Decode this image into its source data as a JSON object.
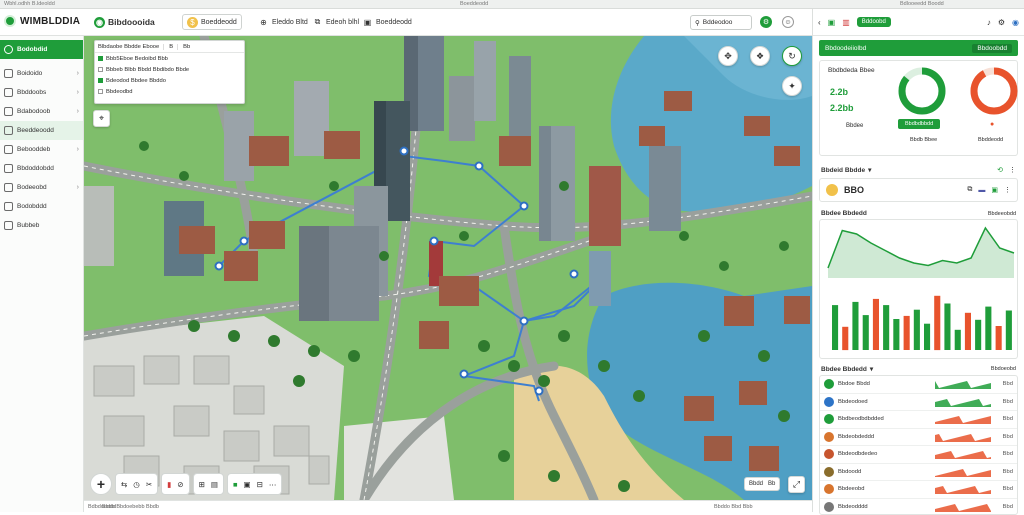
{
  "topstrip": {
    "left": "Wbhl.odhh  B.ldeoldd",
    "center": "Boeddeodd",
    "right": "Bdlooeedd Boodd"
  },
  "header": {
    "brand": "WIMBLDDIA",
    "tabs": [
      {
        "label": "Bibdoooida",
        "icon": "map-pin-icon"
      },
      {
        "label": "Boeddeodd",
        "icon": "coin-icon"
      },
      {
        "label": "Eleddo Bltd",
        "icon": "globe-icon"
      },
      {
        "label": "Edeoh blhl",
        "icon": "layers-icon"
      },
      {
        "label": "Boeddeodd",
        "icon": "building-icon"
      }
    ],
    "search_placeholder": "Bddeodoo",
    "icons": [
      "settings-icon",
      "user-icon"
    ]
  },
  "sidebar": {
    "items": [
      {
        "label": "Bodobdid",
        "icon": "home-icon",
        "state": "active"
      },
      {
        "label": "Boidoido",
        "icon": "list-icon",
        "chevron": true
      },
      {
        "label": "Bbddoobs",
        "icon": "chart-icon",
        "chevron": true
      },
      {
        "label": "Bdabodoob",
        "icon": "mail-icon",
        "chevron": true
      },
      {
        "label": "Beeddeoodd",
        "icon": "grid-icon",
        "state": "highlight"
      },
      {
        "label": "Bebooddeb",
        "icon": "folder-icon",
        "chevron": true
      },
      {
        "label": "Bbdoddobdd",
        "icon": "layers-icon"
      },
      {
        "label": "Bodeeobd",
        "icon": "box-icon",
        "chevron": true
      },
      {
        "label": "Bodobddd",
        "icon": "calendar-icon"
      },
      {
        "label": "Bubbeb",
        "icon": "doc-icon"
      }
    ]
  },
  "map_popup": {
    "top_cells": [
      "Blbdaobe Bbdde Ebooe",
      "B",
      "Bb"
    ],
    "rows": [
      {
        "label": "Bbb5Eboe Bedoibd Bbb",
        "checked": true
      },
      {
        "label": "Bbbeb Blbb Bbdd Bbdibdo Bbde",
        "checked": false
      },
      {
        "label": "Bdeodod Bbdee Bbddo",
        "checked": true
      },
      {
        "label": "Bbdeodbd",
        "checked": false
      }
    ]
  },
  "map_controls": {
    "top_right": [
      "compass-icon",
      "layers-icon",
      "refresh-icon"
    ],
    "extra": "target-icon",
    "left": "location-icon"
  },
  "toolbar": {
    "add": "+",
    "groups": [
      [
        "Bd",
        "Bd",
        "Bd"
      ],
      [
        "Bd",
        "Bd"
      ],
      [
        "Bd",
        "Bd"
      ],
      [
        "Bd",
        "Bbdd"
      ]
    ],
    "right_buttons": [
      "Bbdd",
      "Bb"
    ]
  },
  "footer": {
    "left": "Bdbdooddd",
    "left2": "Bbdo Bbdoebebb Bbdb",
    "right": "Bbddo Bbd Bbb"
  },
  "right_panel": {
    "top_tab": "Bddoobd",
    "green_bar_title": "Bbdoodeiiolbd",
    "green_bar_sub": "Bbdoobdd",
    "stats_title": "Bbdbdeda Bbee",
    "stat_value": "2.2b",
    "stat_value2": "2.2bb",
    "stat_label": "Bbdee",
    "donut_green_button": "Bbdbdbbdd",
    "donut_green_label": "Bbdb Bbee",
    "donut_red_label": "Bbddeodd",
    "donut_green_pct": 0.86,
    "donut_red_pct": 0.92,
    "section2_title": "Bbdeid Bbdde",
    "coin_value": "BBO",
    "section3_title": "Bbdee Bbdedd",
    "section3_right": "Bbdeeobdd",
    "chart1_labels": [
      "B.bd",
      "Bbd",
      "Bbdd"
    ],
    "chart2_labels": [
      "Bbdodde",
      "Bbd",
      "Bbd",
      "Bbd"
    ],
    "section4_title": "Bbdee Bbdedd",
    "section4_right": "Bbdoeobd",
    "list": [
      {
        "name": "Bbdoe Bbdd",
        "value": "Bbd",
        "color": "#1f9d3a",
        "trend": "green"
      },
      {
        "name": "Bbdeodoed",
        "value": "Bbd",
        "color": "#2d74c7",
        "trend": "green"
      },
      {
        "name": "Bbdbeodbdbdded",
        "value": "Bbd",
        "color": "#1f9d3a",
        "trend": "red"
      },
      {
        "name": "Bbdeobdeddd",
        "value": "Bbd",
        "color": "#d8752e",
        "trend": "red"
      },
      {
        "name": "Bbdeodbdedeo",
        "value": "Bbd",
        "color": "#c7552e",
        "trend": "red"
      },
      {
        "name": "Bbdoodd",
        "value": "Bbd",
        "color": "#8a6d2c",
        "trend": "red"
      },
      {
        "name": "Bbdeeobd",
        "value": "Bbd",
        "color": "#d8752e",
        "trend": "red"
      },
      {
        "name": "Bbdeodddd",
        "value": "Bbd",
        "color": "#777777",
        "trend": "red"
      },
      {
        "name": "Bbdeodbbd",
        "value": "Bbd",
        "color": "#1f9d3a",
        "trend": "red"
      }
    ]
  },
  "chart_data": [
    {
      "type": "bar",
      "title": "",
      "values": [
        58,
        30,
        62,
        45,
        66,
        58,
        40,
        44,
        52,
        34,
        70,
        60,
        26,
        48,
        39,
        56,
        31,
        51
      ]
    },
    {
      "type": "line",
      "title": "",
      "values": [
        20,
        95,
        88,
        70,
        55,
        40,
        30,
        25,
        35,
        30,
        40,
        100,
        60,
        50
      ]
    }
  ]
}
